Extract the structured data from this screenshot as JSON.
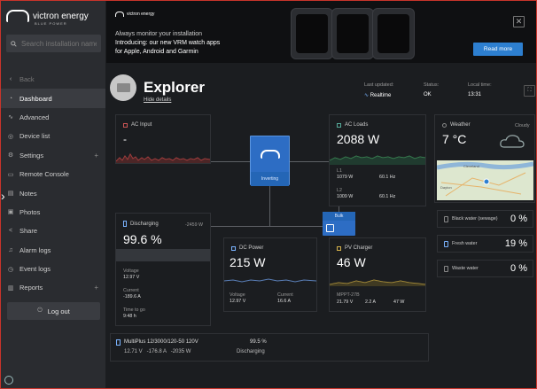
{
  "brand": {
    "name": "victron energy",
    "tagline": "BLUE POWER"
  },
  "search": {
    "placeholder": "Search installation name"
  },
  "nav": [
    {
      "label": "Back",
      "icon": "chevron-left-icon",
      "muted": true
    },
    {
      "label": "Dashboard",
      "icon": "dashboard-icon",
      "active": true
    },
    {
      "label": "Advanced",
      "icon": "chart-icon"
    },
    {
      "label": "Device list",
      "icon": "device-icon"
    },
    {
      "label": "Settings",
      "icon": "gear-icon",
      "plus": true
    },
    {
      "label": "Remote Console",
      "icon": "console-icon"
    },
    {
      "label": "Notes",
      "icon": "notes-icon"
    },
    {
      "label": "Photos",
      "icon": "photo-icon"
    },
    {
      "label": "Share",
      "icon": "share-icon"
    },
    {
      "label": "Alarm logs",
      "icon": "bell-icon"
    },
    {
      "label": "Event logs",
      "icon": "clock-icon"
    },
    {
      "label": "Reports",
      "icon": "report-icon",
      "plus": true
    }
  ],
  "logout": {
    "label": "Log out"
  },
  "banner": {
    "brand": "victron energy",
    "line1": "Always monitor your installation",
    "line2": "Introducing: our new VRM watch apps",
    "line3": "for Apple, Android and Garmin",
    "button": "Read more",
    "close": "✕"
  },
  "site": {
    "title": "Explorer",
    "hide_details": "Hide details",
    "last_updated_label": "Last updated:",
    "last_updated_value": "Realtime",
    "status_label": "Status:",
    "status_value": "OK",
    "local_time_label": "Local time:",
    "local_time_value": "13:31"
  },
  "ac_input": {
    "title": "AC Input",
    "value": "-"
  },
  "inverter": {
    "state": "Inverting"
  },
  "ac_loads": {
    "title": "AC Loads",
    "value": "2088 W",
    "l1_label": "L1",
    "l1_power": "1079 W",
    "l1_freq": "60.1 Hz",
    "l2_label": "L2",
    "l2_power": "1009 W",
    "l2_freq": "60.1 Hz"
  },
  "battery": {
    "title": "Discharging",
    "power": "-2459 W",
    "soc": "99.6 %",
    "voltage_label": "Voltage",
    "voltage_value": "12.97 V",
    "current_label": "Current",
    "current_value": "-189.6 A",
    "ttg_label": "Time to go",
    "ttg_value": "9:48 h"
  },
  "dc_power": {
    "title": "DC Power",
    "value": "215 W",
    "voltage_label": "Voltage",
    "voltage_value": "12.97 V",
    "current_label": "Current",
    "current_value": "16.6 A"
  },
  "pv": {
    "badge": "Bulk",
    "title": "PV Charger",
    "value": "46 W",
    "device": "MPPT-27B",
    "v": "21.79 V",
    "a": "2.2 A",
    "w": "47 W"
  },
  "weather": {
    "title": "Weather",
    "condition": "Cloudy",
    "temp": "7 °C",
    "map_city1": "Cleveland",
    "map_city2": "Dayton"
  },
  "tanks": [
    {
      "label": "Black water (sewage)",
      "value": "0 %"
    },
    {
      "label": "Fresh water",
      "value": "19 %"
    },
    {
      "label": "Waste water",
      "value": "0 %"
    }
  ],
  "footer": {
    "device": "MultiPlus 12/3000/120-50 120V",
    "soc": "99.5 %",
    "readings": "12.71 V   -176.8 A   -2035 W",
    "state": "Discharging"
  }
}
